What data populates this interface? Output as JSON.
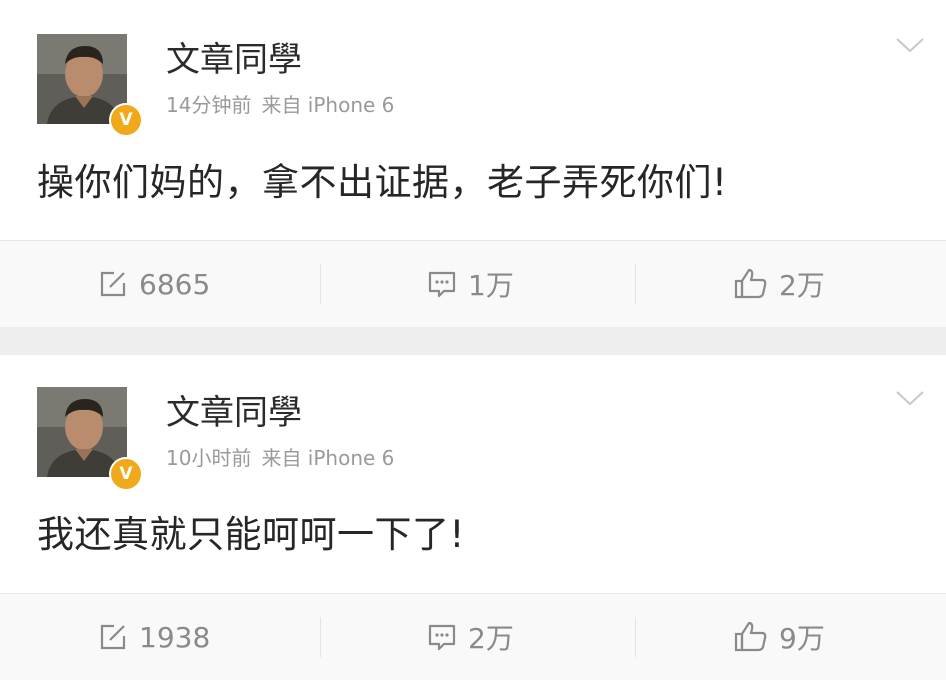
{
  "posts": [
    {
      "username": "文章同學",
      "time": "14分钟前",
      "source": "来自 iPhone 6",
      "verified_badge": "V",
      "content": "操你们妈的，拿不出证据，老子弄死你们!",
      "reposts": "6865",
      "comments": "1万",
      "likes": "2万"
    },
    {
      "username": "文章同學",
      "time": "10小时前",
      "source": "来自 iPhone 6",
      "verified_badge": "V",
      "content": "我还真就只能呵呵一下了!",
      "reposts": "1938",
      "comments": "2万",
      "likes": "9万"
    }
  ],
  "colors": {
    "text": "#2b2b2b",
    "meta": "#9a9a9a",
    "badge": "#f0a91b",
    "action": "#8a8a8a",
    "separator": "#eeeeee"
  },
  "icons": [
    "chevron-down-icon",
    "repost-icon",
    "comment-icon",
    "like-icon"
  ]
}
